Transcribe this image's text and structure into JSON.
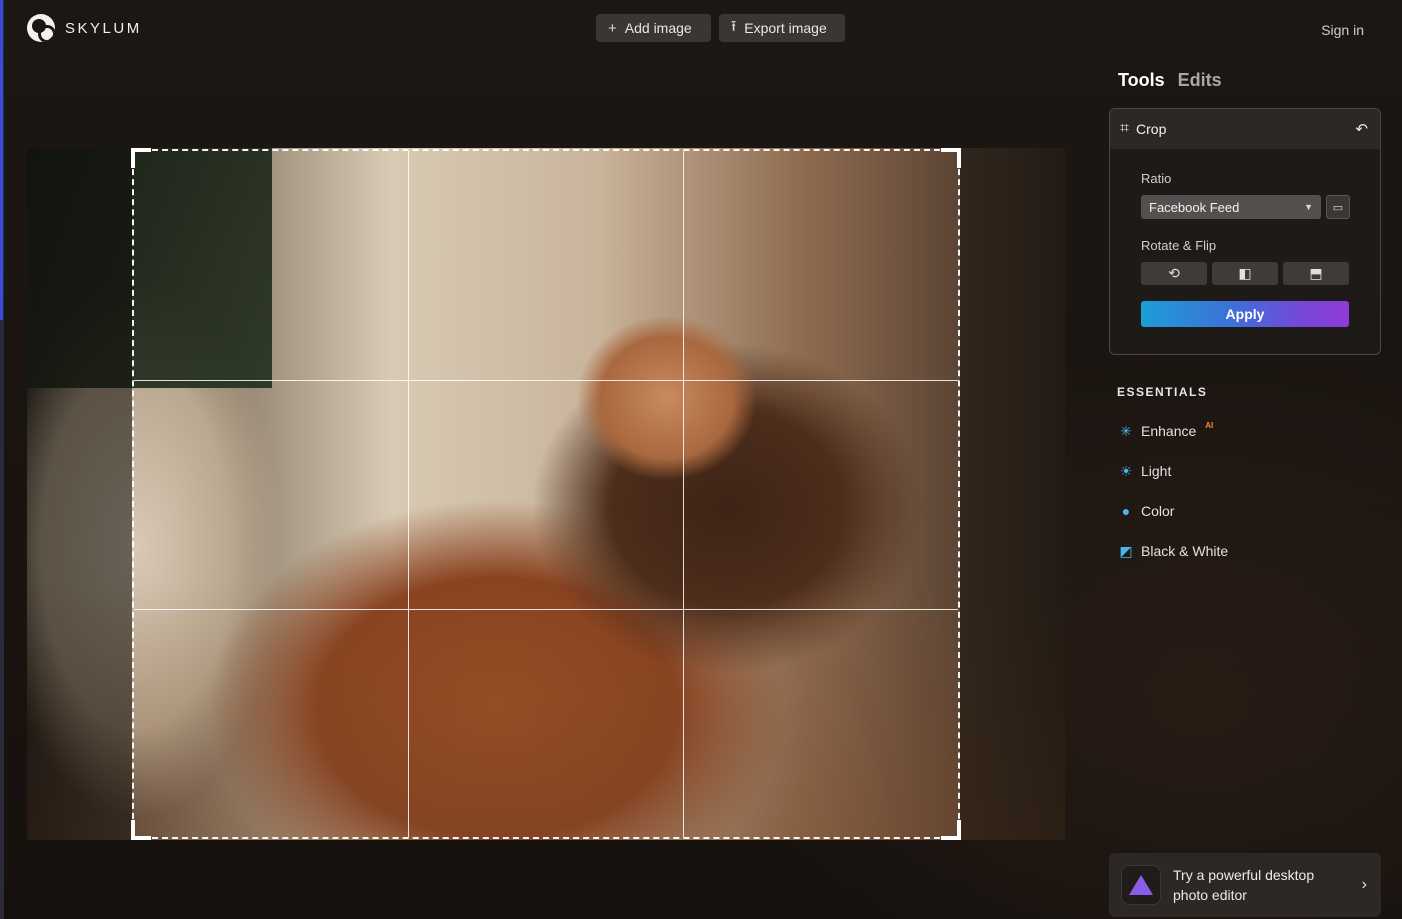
{
  "header": {
    "brand": "SKYLUM",
    "add_image": "Add image",
    "export_image": "Export image",
    "sign_in": "Sign in",
    "add_icon": "+",
    "export_icon": "⭱"
  },
  "panel": {
    "tabs": [
      "Tools",
      "Edits"
    ],
    "crop": {
      "title": "Crop",
      "ratio_label": "Ratio",
      "ratio_value": "Facebook Feed",
      "rotate_label": "Rotate & Flip",
      "apply": "Apply"
    },
    "essentials_title": "ESSENTIALS",
    "essentials": [
      {
        "label": "Enhance",
        "badge": "AI",
        "icon": "sparkle-icon"
      },
      {
        "label": "Light",
        "icon": "sun-icon"
      },
      {
        "label": "Color",
        "icon": "palette-icon"
      },
      {
        "label": "Black & White",
        "icon": "bw-icon"
      }
    ],
    "promo": {
      "line1": "Try a powerful desktop",
      "line2": "photo editor"
    }
  },
  "colors": {
    "accent_blue": "#45b7ee",
    "apply_gradient_start": "#1b9ed6",
    "apply_gradient_end": "#8e3bd6",
    "ai_badge": "#f08b3c"
  }
}
